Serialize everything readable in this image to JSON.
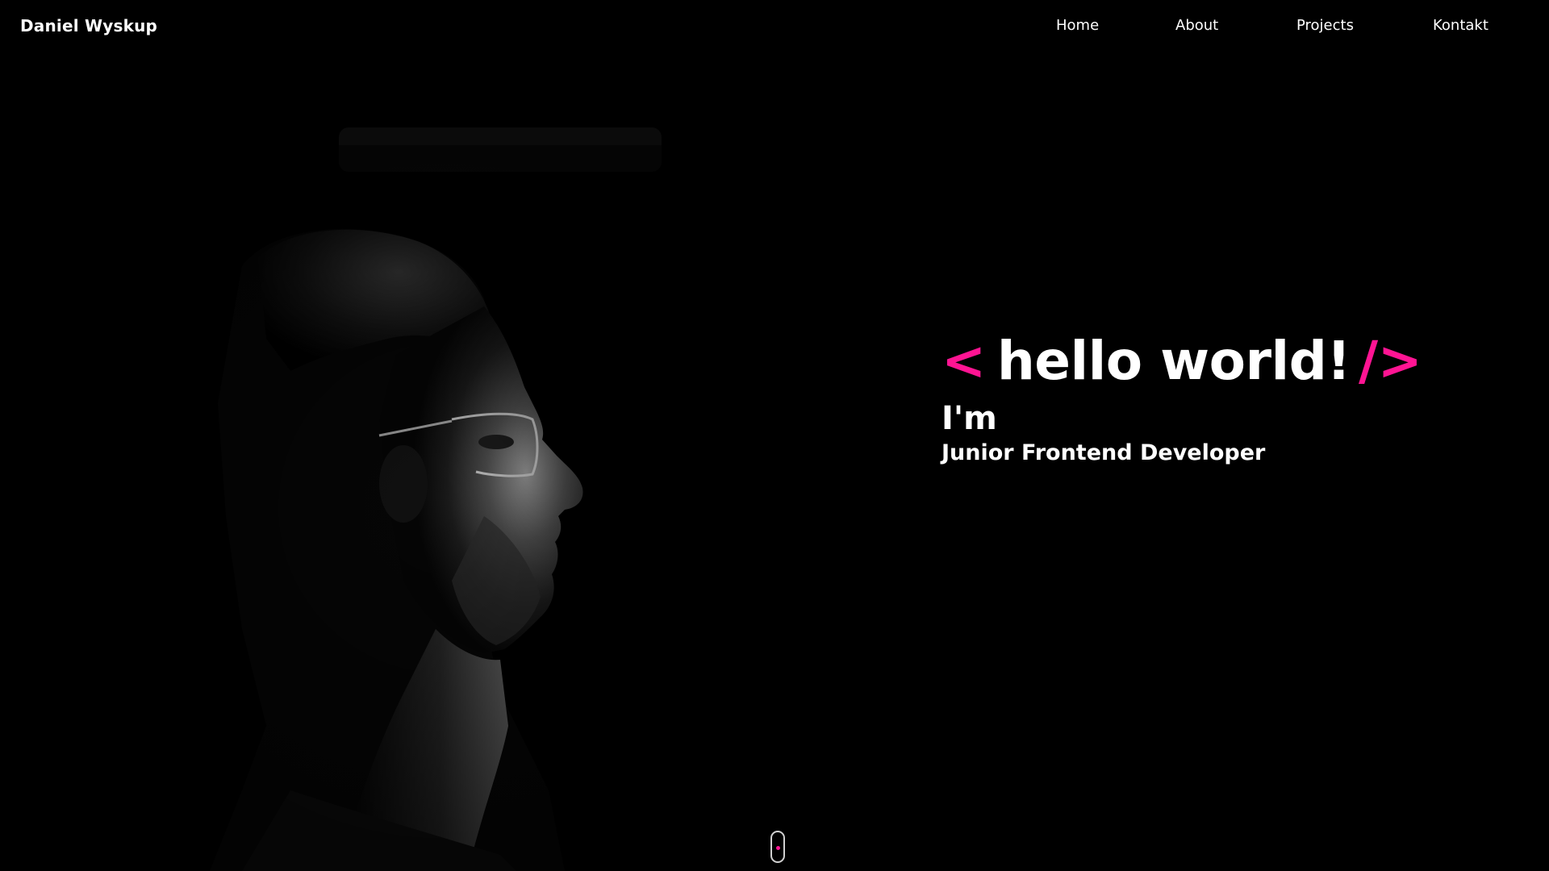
{
  "header": {
    "brand": "Daniel Wyskup",
    "nav": [
      "Home",
      "About",
      "Projects",
      "Kontakt"
    ]
  },
  "hero": {
    "open_tag": "<",
    "greeting": "hello world!",
    "close_tag": "/>",
    "intro": "I'm",
    "role": "Junior Frontend Developer"
  },
  "colors": {
    "background": "#000000",
    "text": "#ffffff",
    "accent": "#ff1493"
  },
  "icons": {
    "scroll": "mouse-scroll-icon"
  }
}
